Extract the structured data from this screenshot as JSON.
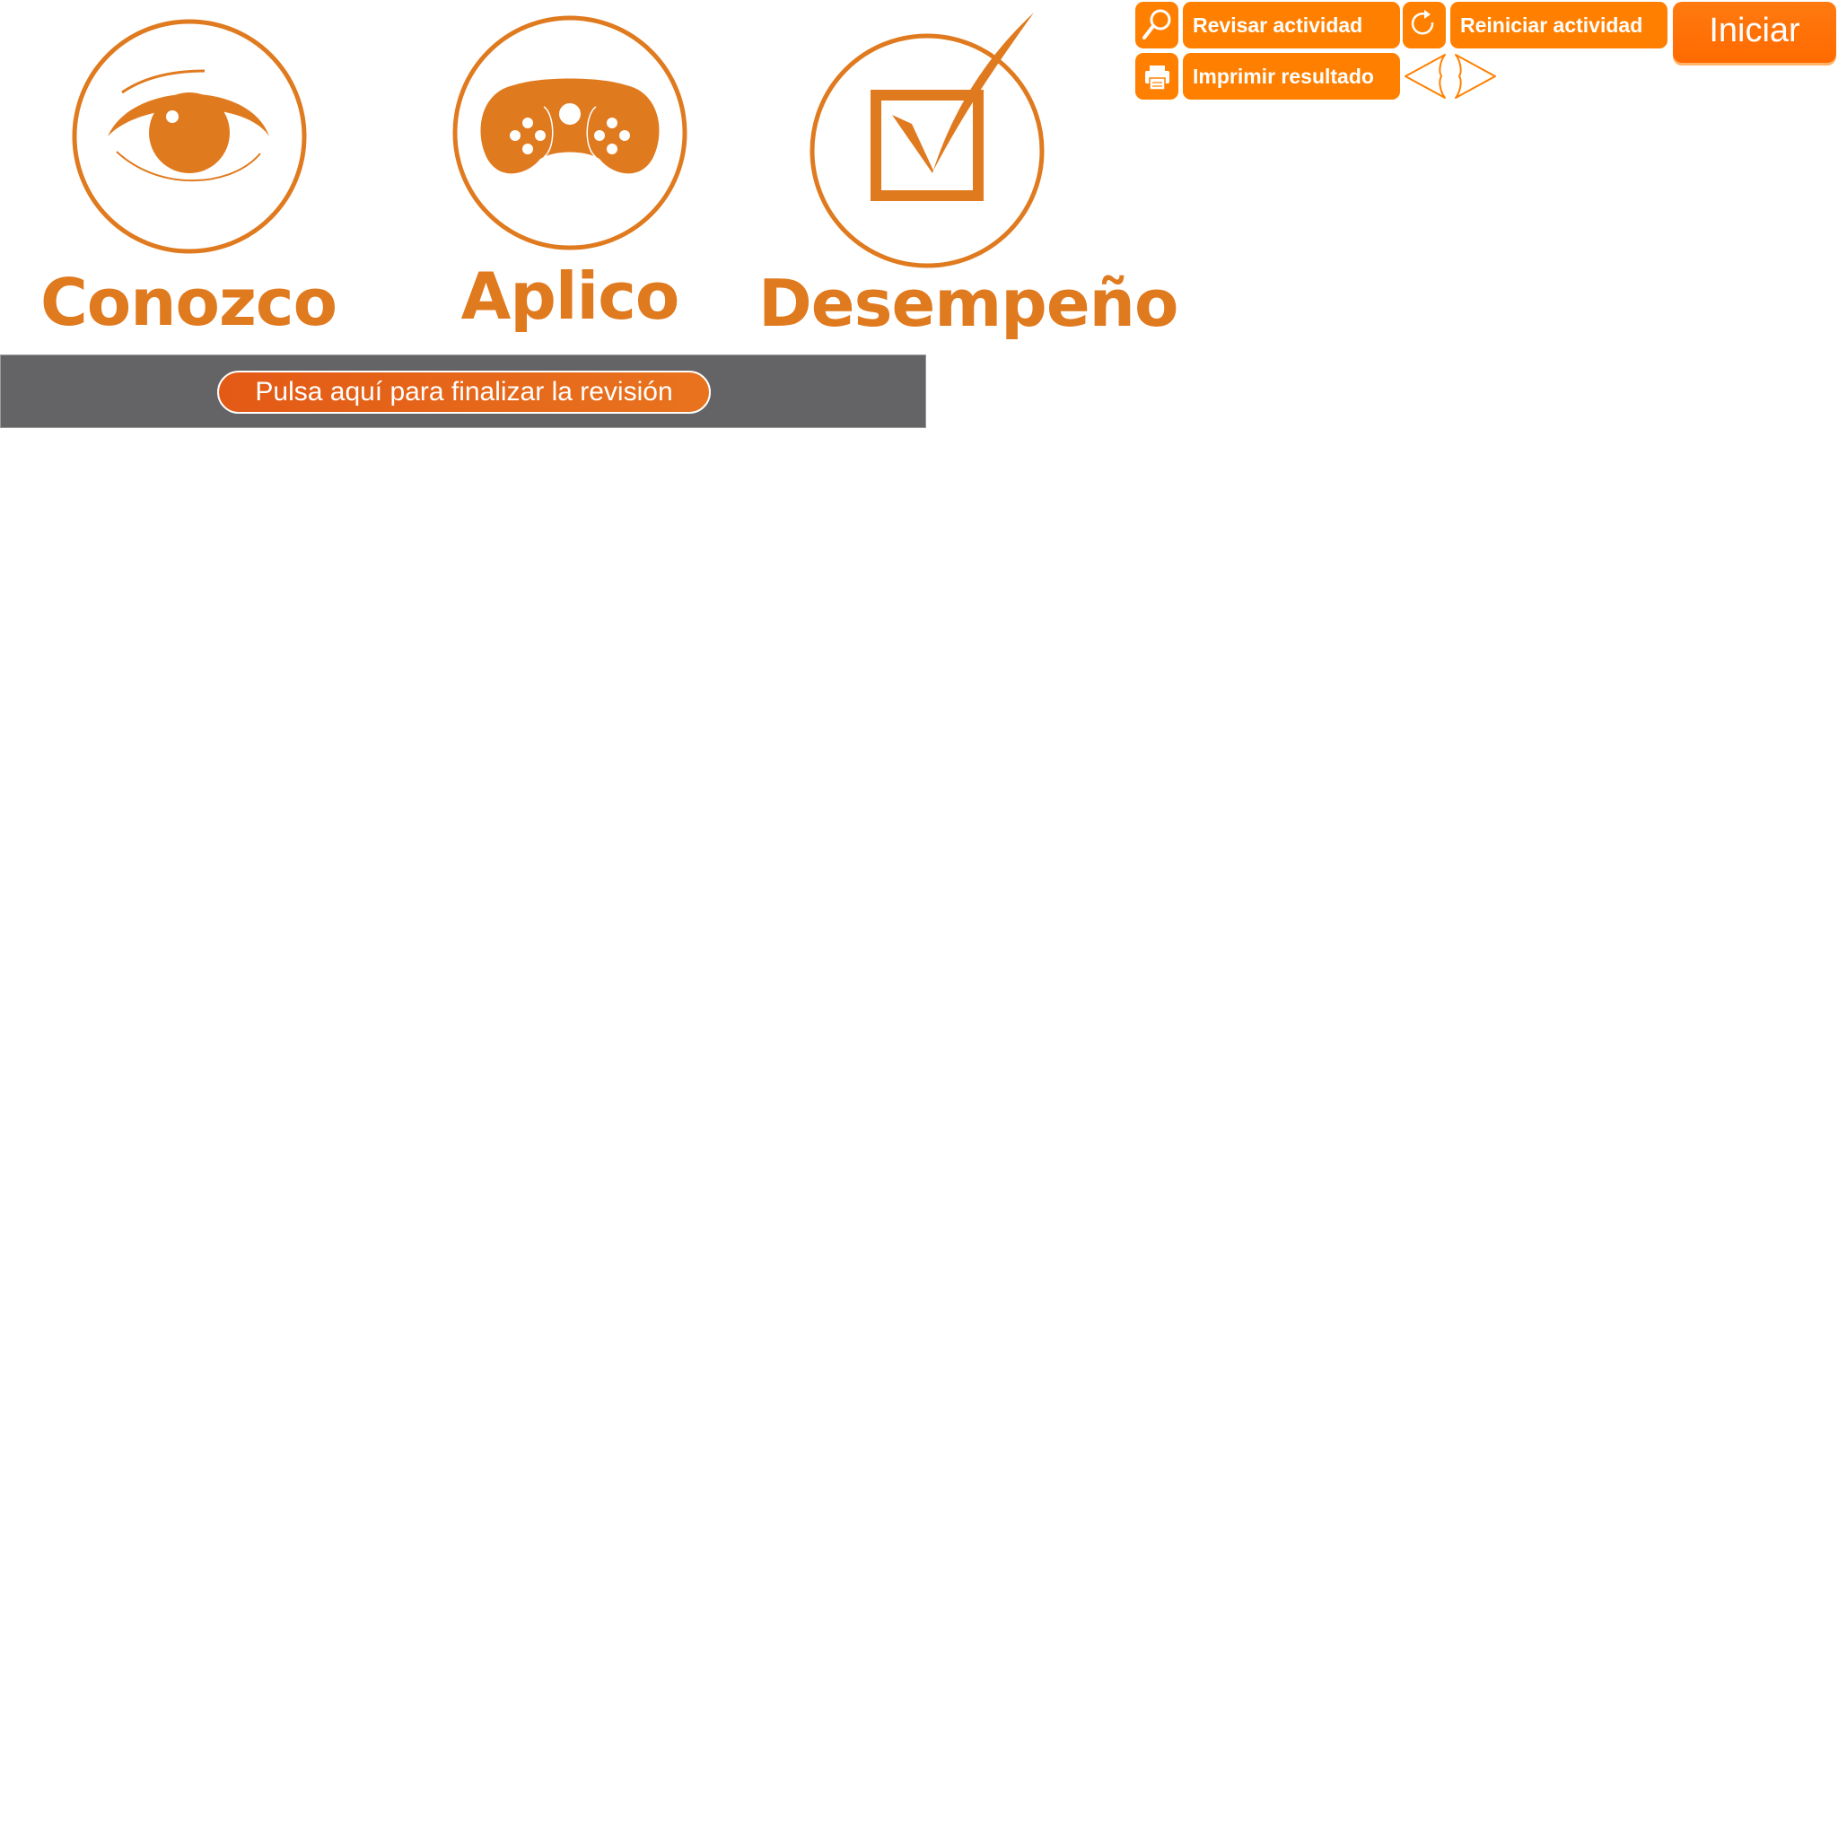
{
  "colors": {
    "brand_orange": "#e07a1f",
    "toolbar_orange": "#ff8000",
    "bar_gray": "#646366"
  },
  "sections": [
    {
      "label": "Conozco",
      "icon": "eye-icon"
    },
    {
      "label": "Aplico",
      "icon": "gamepad-icon"
    },
    {
      "label": "Desempeño",
      "icon": "checkbox-icon"
    }
  ],
  "review": {
    "finish_label": "Pulsa aquí para finalizar la revisión"
  },
  "toolbar": {
    "review_label": "Revisar actividad",
    "review_icon": "magnifier-icon",
    "restart_label": "Reiniciar actividad",
    "restart_icon": "refresh-icon",
    "print_label": "Imprimir resultado",
    "print_icon": "printer-icon",
    "start_label": "Iniciar",
    "nav_icons": [
      "arrow-left-icon",
      "arrow-right-icon"
    ]
  }
}
